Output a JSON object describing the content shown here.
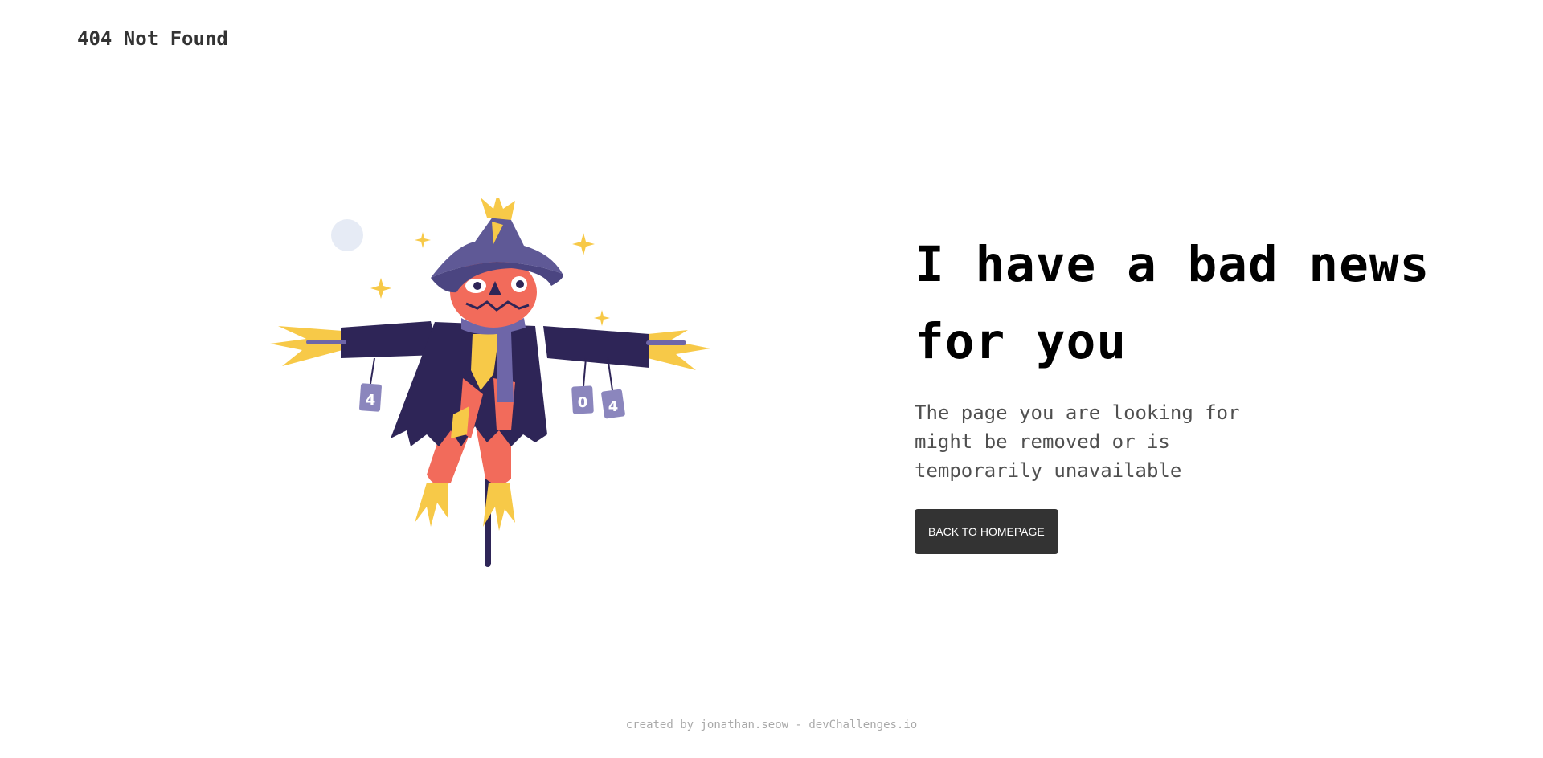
{
  "header": {
    "brand": "404 Not Found"
  },
  "illustration": {
    "icon": "scarecrow-illustration",
    "cans": [
      "4",
      "0",
      "4"
    ],
    "colors": {
      "hat": "#5f5996",
      "coat": "#2e2557",
      "face": "#f26b5b",
      "straw": "#f7c948",
      "scarf": "#6e66a8",
      "cans": "#8b86bd",
      "moon": "#e6ebf5"
    }
  },
  "main": {
    "headline_line1": "I have a bad news",
    "headline_line2": "for you",
    "message_line1": "The page you are looking for",
    "message_line2": "might be removed or is",
    "message_line3": "temporarily unavailable",
    "button_label": "BACK TO HOMEPAGE"
  },
  "footer": {
    "credit": "created by jonathan.seow - devChallenges.io"
  }
}
